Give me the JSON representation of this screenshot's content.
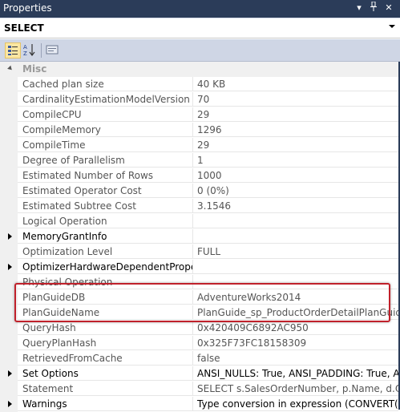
{
  "panel": {
    "title": "Properties",
    "pin_icon": "pin-icon",
    "close_icon": "close-icon",
    "dropdown_icon": "chevron-down-icon"
  },
  "object_selector": {
    "value": "SELECT"
  },
  "toolbar": {
    "buttons": [
      "categorized-icon",
      "alphabetical-icon",
      "property-pages-icon"
    ]
  },
  "category": {
    "label": "Misc"
  },
  "properties": [
    {
      "name": "Cached plan size",
      "value": "40 KB"
    },
    {
      "name": "CardinalityEstimationModelVersion",
      "value": "70"
    },
    {
      "name": "CompileCPU",
      "value": "29"
    },
    {
      "name": "CompileMemory",
      "value": "1296"
    },
    {
      "name": "CompileTime",
      "value": "29"
    },
    {
      "name": "Degree of Parallelism",
      "value": "1"
    },
    {
      "name": "Estimated Number of Rows",
      "value": "1000"
    },
    {
      "name": "Estimated Operator Cost",
      "value": "0 (0%)"
    },
    {
      "name": "Estimated Subtree Cost",
      "value": "3.1546"
    },
    {
      "name": "Logical Operation",
      "value": ""
    },
    {
      "name": "MemoryGrantInfo",
      "value": "",
      "expandable": true
    },
    {
      "name": "Optimization Level",
      "value": "FULL"
    },
    {
      "name": "OptimizerHardwareDependentProperties",
      "value": "",
      "expandable": true
    },
    {
      "name": "Physical Operation",
      "value": ""
    },
    {
      "name": "PlanGuideDB",
      "value": "AdventureWorks2014"
    },
    {
      "name": "PlanGuideName",
      "value": "PlanGuide_sp_ProductOrderDetailPlanGuide"
    },
    {
      "name": "QueryHash",
      "value": "0x420409C6892AC950"
    },
    {
      "name": "QueryPlanHash",
      "value": "0x325F73FC18158309"
    },
    {
      "name": "RetrievedFromCache",
      "value": "false"
    },
    {
      "name": "Set Options",
      "value": "ANSI_NULLS: True, ANSI_PADDING: True, ANSI_",
      "expandable": true
    },
    {
      "name": "Statement",
      "value": "SELECT s.SalesOrderNumber, p.Name, d.OrderC"
    },
    {
      "name": "Warnings",
      "value": "Type conversion in expression (CONVERT(nvarc",
      "expandable": true
    }
  ],
  "colors": {
    "title_bg": "#2b3c59",
    "toolbar_bg": "#cfd6e5",
    "highlight": "#c0212b"
  }
}
